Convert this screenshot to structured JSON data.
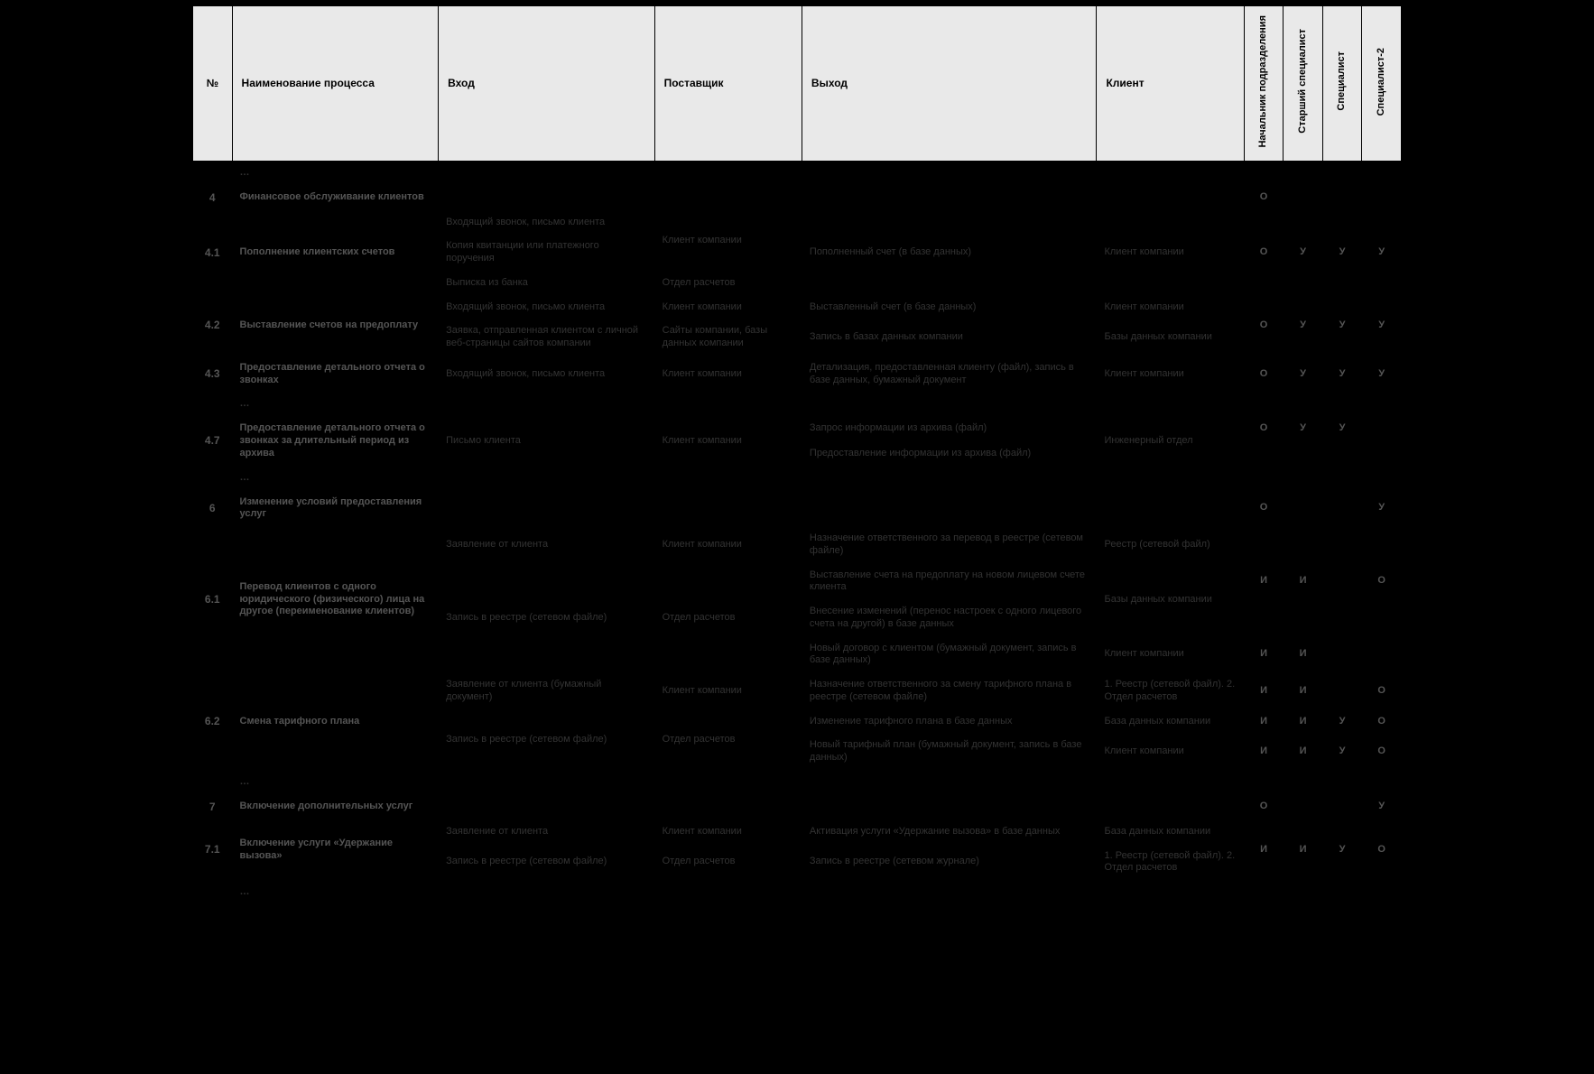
{
  "headers": {
    "num": "№",
    "name": "Наименование процесса",
    "input": "Вход",
    "supplier": "Поставщик",
    "output": "Выход",
    "client": "Клиент",
    "role1": "Начальник подразделения",
    "role2": "Старший специалист",
    "role3": "Специалист",
    "role4": "Специалист-2"
  },
  "ellipsis": "…",
  "rows": {
    "r4": {
      "num": "4",
      "name": "Финансовое обслуживание клиентов",
      "c1": "О"
    },
    "r41": {
      "num": "4.1",
      "name": "Пополнение клиентских счетов",
      "in1": "Входящий звонок, письмо клиента",
      "in2": "Копия квитанции или платежного поручения",
      "in3": "Выписка из банка",
      "sup1": "Клиент компании",
      "sup3": "Отдел расчетов",
      "out": "Пополненный  счет (в базе данных)",
      "cli": "Клиент компании",
      "c1": "О",
      "c2": "У",
      "c3": "У",
      "c4": "У"
    },
    "r42": {
      "num": "4.2",
      "name": "Выставление счетов на предоплату",
      "in1": "Входящий звонок, письмо клиента",
      "in2": "Заявка, отправленная клиентом с личной веб-страницы сайтов компании",
      "sup1": "Клиент компании",
      "sup2": "Сайты компании, базы данных компании",
      "out1": "Выставленный  счет (в базе данных)",
      "out2": "Запись в базах данных компании",
      "cli1": "Клиент компании",
      "cli2": "Базы данных  компании",
      "c1": "О",
      "c2": "У",
      "c3": "У",
      "c4": "У"
    },
    "r43": {
      "num": "4.3",
      "name": "Предоставление детального отчета о звонках",
      "in": "Входящий звонок, письмо клиента",
      "sup": "Клиент компании",
      "out": "Детализация, предоставленная клиенту (файл), запись в базе данных, бумажный документ",
      "cli": "Клиент компании",
      "c1": "О",
      "c2": "У",
      "c3": "У",
      "c4": "У"
    },
    "r47": {
      "num": "4.7",
      "name": "Предоставление детального отчета о звон­ках за длительный период из архива",
      "in": "Письмо клиента",
      "sup": "Клиент компании",
      "out1": "Запрос информации из архива (файл)",
      "out2": "Предоставление информации из архива (файл)",
      "cli": "Инженерный отдел",
      "c1": "О",
      "c2": "У",
      "c3": "У"
    },
    "r6": {
      "num": "6",
      "name": "Изменение условий предоставления услуг",
      "c1": "О",
      "c4": "У"
    },
    "r61": {
      "num": "6.1",
      "name": "Перевод клиентов с одного юридического (физического) лица на другое (переиме­нование клиентов)",
      "in1": "Заявление от клиента",
      "in2": "Запись в реестре (сетевом файле)",
      "sup1": "Клиент компании",
      "sup2": "Отдел расчетов",
      "out1": "Назначение ответственного за перевод в реестре (сетевом файле)",
      "out2": "Выставление счета на предоплату на новом лицевом счете клиента",
      "out3": "Внесение изменений (перенос настроек с одного лицевого счета на другой)  в базе данных",
      "out4": "Новый договор с клиентом (бумажный документ, запись в базе данных)",
      "cli1": "Реестр (сетевой файл)",
      "cli2": "Базы данных  компании",
      "cli4": "Клиент компании",
      "c1a": "И",
      "c2a": "И",
      "c4a": "О",
      "c1b": "И",
      "c2b": "И"
    },
    "r62": {
      "num": "6.2",
      "name": "Смена тарифного плана",
      "in1": "Заявление от клиента (бумажный документ)",
      "in2": "Запись в реестре (сетевом файле)",
      "sup1": "Клиент компании",
      "sup2": "Отдел расчетов",
      "out1": "Назначение ответственного за смену тарифного плана в реестре (сетевом файле)",
      "out2": "Изменение тарифного плана  в базе данных",
      "out3": "Новый тарифный план (бумажный документ, запись в базе данных)",
      "cli1": "1. Реестр (сетевой файл). 2. Отдел расчетов",
      "cli2": "База данных компании",
      "cli3": "Клиент компании",
      "c1a": "И",
      "c2a": "И",
      "c4a": "О",
      "c1b": "И",
      "c2b": "И",
      "c3b": "У",
      "c4b": "О",
      "c1c": "И",
      "c2c": "И",
      "c3c": "У",
      "c4c": "О"
    },
    "r7": {
      "num": "7",
      "name": "Включение дополнительных услуг",
      "c1": "О",
      "c4": "У"
    },
    "r71": {
      "num": "7.1",
      "name": "Включение услуги «Удержание вызова»",
      "in1": "Заявление от клиента",
      "in2": "Запись в реестре (сетевом файле)",
      "sup1": "Клиент компании",
      "sup2": "Отдел расчетов",
      "out1": "Активация услуги «Удержание вызова» в базе данных",
      "out2": "Запись в реестре (сетевом журнале)",
      "cli1": "База данных компании",
      "cli2": "1. Реестр (сетевой файл). 2. Отдел расчетов",
      "c1": "И",
      "c2": "И",
      "c3": "У",
      "c4": "О"
    }
  }
}
